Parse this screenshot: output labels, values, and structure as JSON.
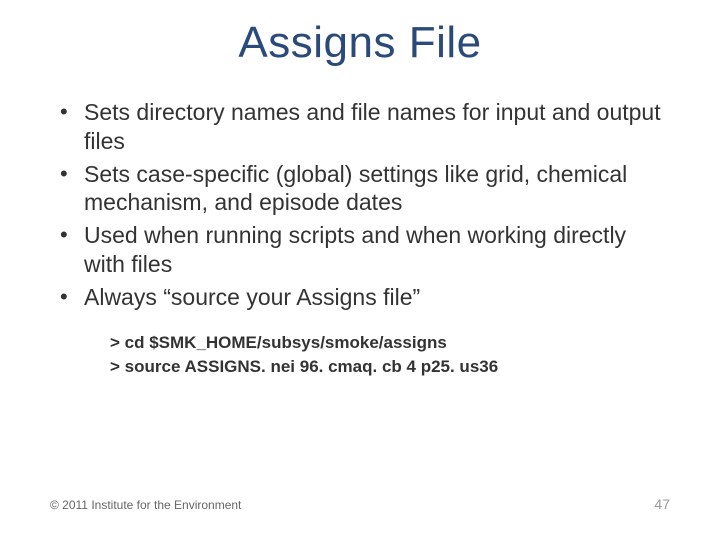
{
  "title": "Assigns File",
  "bullets": [
    "Sets directory names and file names for input and output files",
    "Sets case-specific (global) settings like grid, chemical mechanism, and episode dates",
    "Used when running scripts and when working directly with files",
    "Always “source your Assigns file”"
  ],
  "commands": [
    "> cd $SMK_HOME/subsys/smoke/assigns",
    "> source ASSIGNS. nei 96. cmaq. cb 4 p25. us36"
  ],
  "footer": {
    "copyright": "© 2011 Institute for the Environment",
    "page": "47"
  }
}
